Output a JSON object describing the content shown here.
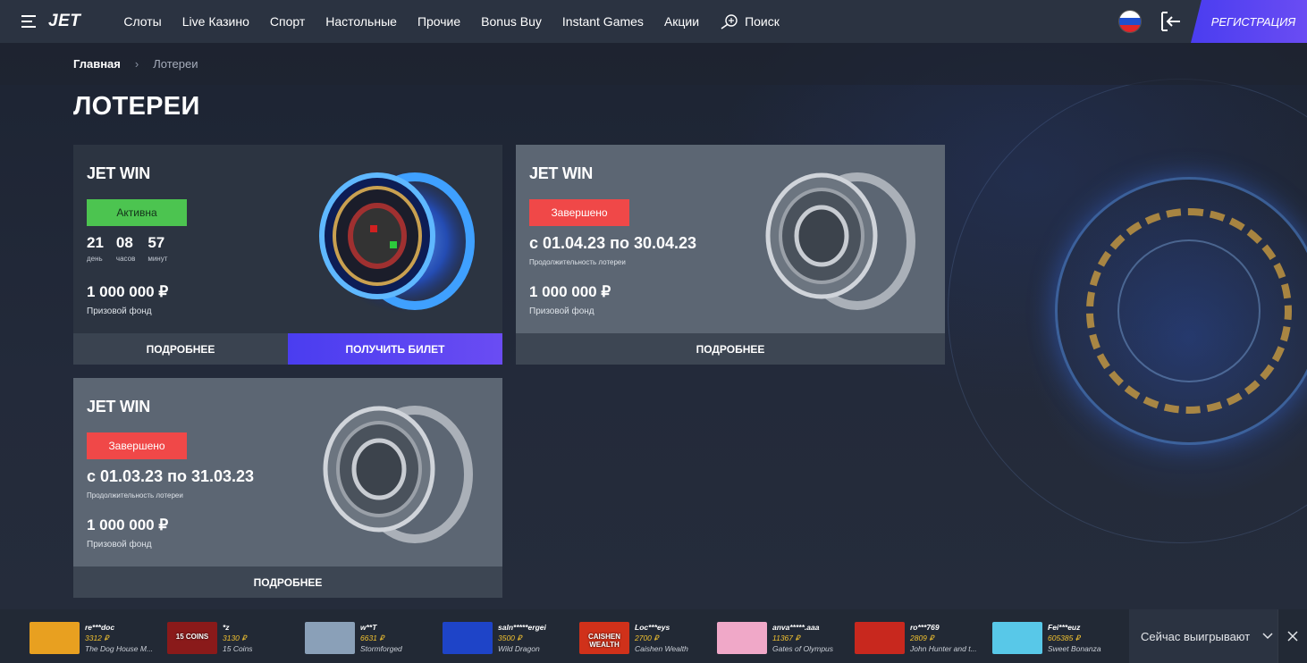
{
  "header": {
    "logo": "JET",
    "nav": [
      "Слоты",
      "Live Казино",
      "Спорт",
      "Настольные",
      "Прочие",
      "Bonus Buy",
      "Instant Games",
      "Акции"
    ],
    "search_label": "Поиск",
    "register_label": "Регистрация",
    "flag_colors": [
      "#ffffff",
      "#1f4fcf",
      "#e0262a"
    ]
  },
  "breadcrumb": {
    "home": "Главная",
    "current": "Лотереи"
  },
  "page_title": "ЛОТЕРЕИ",
  "cards": [
    {
      "name": "JET WIN",
      "status": "Активна",
      "timer": [
        {
          "value": "21",
          "label": "день"
        },
        {
          "value": "08",
          "label": "часов"
        },
        {
          "value": "57",
          "label": "минут"
        }
      ],
      "prize": "1 000 000 ₽",
      "prize_label": "Призовой фонд",
      "more_label": "Подробнее",
      "ticket_label": "Получить билет"
    },
    {
      "name": "JET WIN",
      "status": "Завершено",
      "period": "с 01.04.23 по 30.04.23",
      "period_label": "Продолжительность лотереи",
      "prize": "1 000 000 ₽",
      "prize_label": "Призовой фонд",
      "more_label": "Подробнее"
    },
    {
      "name": "JET WIN",
      "status": "Завершено",
      "period": "с 01.03.23 по 31.03.23",
      "period_label": "Продолжительность лотереи",
      "prize": "1 000 000 ₽",
      "prize_label": "Призовой фонд",
      "more_label": "Подробнее"
    }
  ],
  "ticker": {
    "wins": [
      {
        "user": "re***doc",
        "amount": "3312 ₽",
        "game": "The Dog House M...",
        "thumb_color": "#e8a020"
      },
      {
        "user": "*z",
        "amount": "3130 ₽",
        "game": "15 Coins",
        "thumb_color": "#8a1a1a",
        "thumb_text": "15 COINS"
      },
      {
        "user": "w**T",
        "amount": "6631 ₽",
        "game": "Stormforged",
        "thumb_color": "#8aa0b8"
      },
      {
        "user": "saln*****ergei",
        "amount": "3500 ₽",
        "game": "Wild Dragon",
        "thumb_color": "#1e44c8"
      },
      {
        "user": "Loc***eys",
        "amount": "2700 ₽",
        "game": "Caishen Wealth",
        "thumb_color": "#d0311a",
        "thumb_text": "CAISHEN WEALTH"
      },
      {
        "user": "anva*****.aaa",
        "amount": "11367 ₽",
        "game": "Gates of Olympus",
        "thumb_color": "#f0a8c8"
      },
      {
        "user": "ro***769",
        "amount": "2809 ₽",
        "game": "John Hunter and t...",
        "thumb_color": "#c8281e"
      },
      {
        "user": "Fei***euz",
        "amount": "605385 ₽",
        "game": "Sweet Bonanza",
        "thumb_color": "#58c8e8"
      }
    ],
    "now_winning_label": "Сейчас выигрывают"
  }
}
